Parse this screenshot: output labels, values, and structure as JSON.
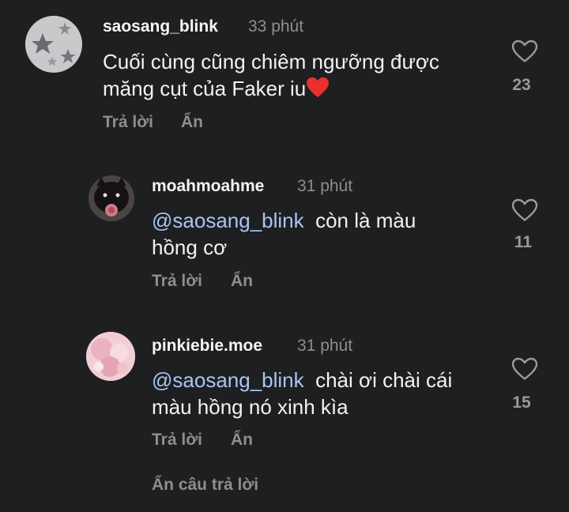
{
  "comments": [
    {
      "username": "saosang_blink",
      "time": "33 phút",
      "text_line1": "Cuối cùng cũng chiêm ngưỡng được",
      "text_line2": "măng cụt của Faker iu",
      "emoji": "red-heart-emoji",
      "reply_label": "Trả lời",
      "hide_label": "Ẩn",
      "likes": "23"
    },
    {
      "username": "moahmoahme",
      "time": "31 phút",
      "mention": "@saosang_blink",
      "text_line1": "còn là màu",
      "text_line2": "hồng cơ",
      "reply_label": "Trả lời",
      "hide_label": "Ẩn",
      "likes": "11"
    },
    {
      "username": "pinkiebie.moe",
      "time": "31 phút",
      "mention": "@saosang_blink",
      "text_line1": "chài ơi chài cái",
      "text_line2": "màu hồng nó xinh kìa",
      "reply_label": "Trả lời",
      "hide_label": "Ẩn",
      "likes": "15"
    }
  ],
  "hide_replies_label": "Ẩn câu trả lời",
  "colors": {
    "background": "#1e1f21",
    "mention": "#a9c5f2",
    "muted": "#8e8e90",
    "heart_red": "#e8302f"
  },
  "icons": [
    "heart-outline-icon",
    "red-heart-emoji"
  ]
}
